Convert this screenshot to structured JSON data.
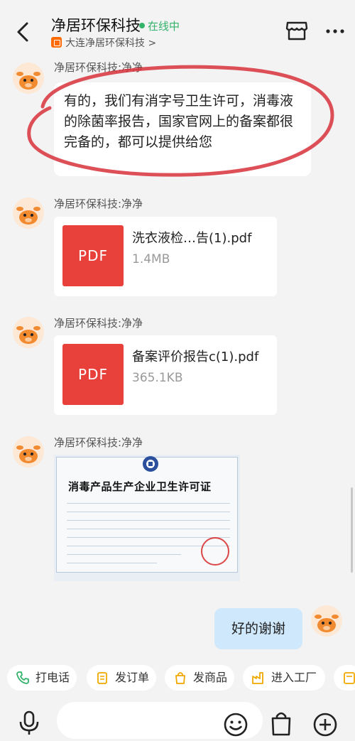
{
  "header": {
    "title": "净居环保科技",
    "status": "在线中",
    "shop_name": "大连净居环保科技 >",
    "status_color": "#33b36a",
    "icons": [
      "back-arrow-icon",
      "store-icon",
      "more-icon"
    ]
  },
  "messages": [
    {
      "sender": "净居环保科技:净净",
      "type": "text",
      "text": "有的，我们有消字号卫生许可，消毒液的除菌率报告，国家官网上的备案都很完备的，都可以提供给您"
    },
    {
      "sender": "净居环保科技:净净",
      "type": "file",
      "file_icon_label": "PDF",
      "file_name": "洗衣液检…告(1).pdf",
      "file_size": "1.4MB"
    },
    {
      "sender": "净居环保科技:净净",
      "type": "file",
      "file_icon_label": "PDF",
      "file_name": "备案评价报告c(1).pdf",
      "file_size": "365.1KB"
    },
    {
      "sender": "净居环保科技:净净",
      "type": "image",
      "image_title": "消毒产品生产企业卫生许可证"
    }
  ],
  "my_message": {
    "text": "好的谢谢"
  },
  "shortcuts": [
    {
      "label": "打电话",
      "icon": "phone-icon"
    },
    {
      "label": "发订单",
      "icon": "order-icon"
    },
    {
      "label": "发商品",
      "icon": "shopping-bag-icon"
    },
    {
      "label": "进入工厂",
      "icon": "factory-icon"
    }
  ],
  "input": {
    "placeholder": ""
  },
  "colors": {
    "accent": "#ff6a00",
    "pdf": "#e8403a",
    "my_bubble": "#cfe8fb",
    "annotation": "#d7313b"
  }
}
